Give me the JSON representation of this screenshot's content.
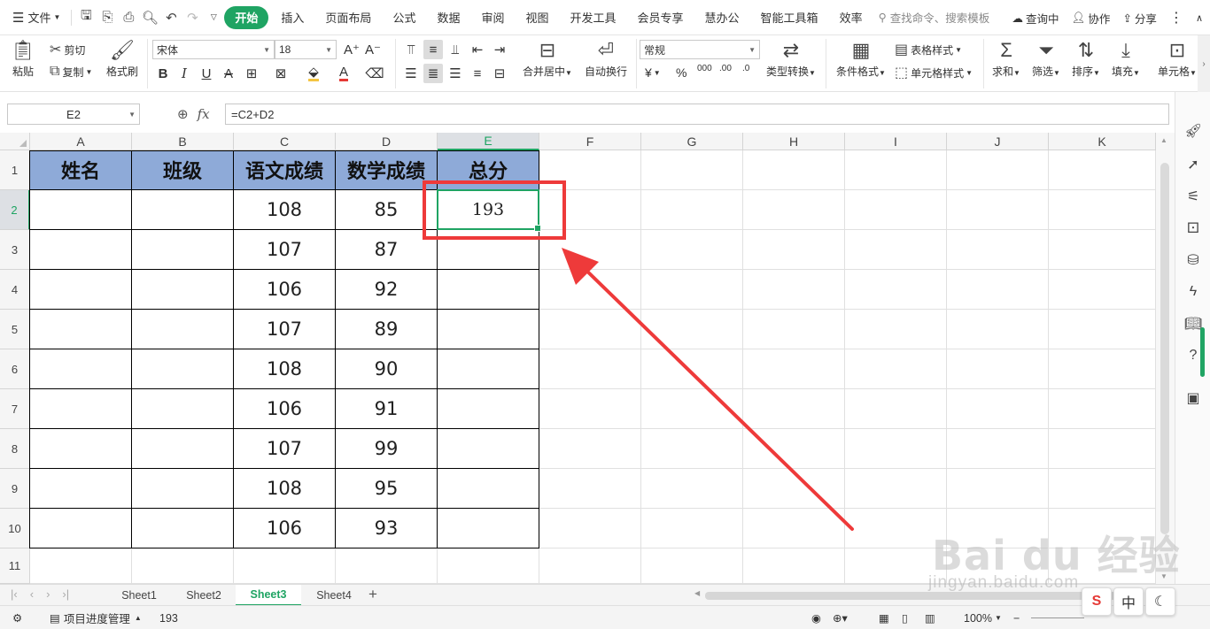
{
  "topbar": {
    "file_menu": "文件",
    "tabs": [
      "开始",
      "插入",
      "页面布局",
      "公式",
      "数据",
      "审阅",
      "视图",
      "开发工具",
      "会员专享",
      "慧办公",
      "智能工具箱",
      "效率"
    ],
    "search_placeholder": "查找命令、搜索模板",
    "right": {
      "review": "查询中",
      "collab": "协作",
      "share": "分享"
    }
  },
  "ribbon": {
    "paste": "粘贴",
    "cut": "剪切",
    "copy": "复制",
    "format_painter": "格式刷",
    "font_name": "宋体",
    "font_size": "18",
    "merge_center": "合并居中",
    "wrap_text": "自动换行",
    "number_format": "常规",
    "type_convert": "类型转换",
    "cond_format": "条件格式",
    "table_style": "表格样式",
    "cell_style": "单元格样式",
    "sum": "求和",
    "filter": "筛选",
    "sort": "排序",
    "fill": "填充",
    "cell": "单元格",
    "percent": "%",
    "currency": "¥",
    "thousands": "000",
    "dec_inc": ".00",
    "dec_dec": ".0"
  },
  "formula_bar": {
    "name_box": "E2",
    "fx": "fx",
    "formula": "=C2+D2"
  },
  "sheet": {
    "columns": [
      "A",
      "B",
      "C",
      "D",
      "E",
      "F",
      "G",
      "H",
      "I",
      "J",
      "K"
    ],
    "rows": [
      "1",
      "2",
      "3",
      "4",
      "5",
      "6",
      "7",
      "8",
      "9",
      "10",
      "11"
    ],
    "headers": [
      "姓名",
      "班级",
      "语文成绩",
      "数学成绩",
      "总分"
    ],
    "data": [
      [
        "",
        "",
        "108",
        "85",
        "193"
      ],
      [
        "",
        "",
        "107",
        "87",
        ""
      ],
      [
        "",
        "",
        "106",
        "92",
        ""
      ],
      [
        "",
        "",
        "107",
        "89",
        ""
      ],
      [
        "",
        "",
        "108",
        "90",
        ""
      ],
      [
        "",
        "",
        "106",
        "91",
        ""
      ],
      [
        "",
        "",
        "107",
        "99",
        ""
      ],
      [
        "",
        "",
        "108",
        "95",
        ""
      ],
      [
        "",
        "",
        "106",
        "93",
        ""
      ]
    ],
    "selected_cell": "E2"
  },
  "sheet_tabs": [
    "Sheet1",
    "Sheet2",
    "Sheet3",
    "Sheet4"
  ],
  "active_sheet": "Sheet3",
  "statusbar": {
    "project": "项目进度管理",
    "value": "193",
    "zoom": "100%"
  },
  "ime": {
    "mode": "中"
  },
  "watermark": {
    "brand": "Bai du 经验",
    "url": "jingyan.baidu.com"
  },
  "colors": {
    "accent": "#1fa463",
    "header_fill": "#8eaad8",
    "annotation_red": "#ee3a3a"
  }
}
